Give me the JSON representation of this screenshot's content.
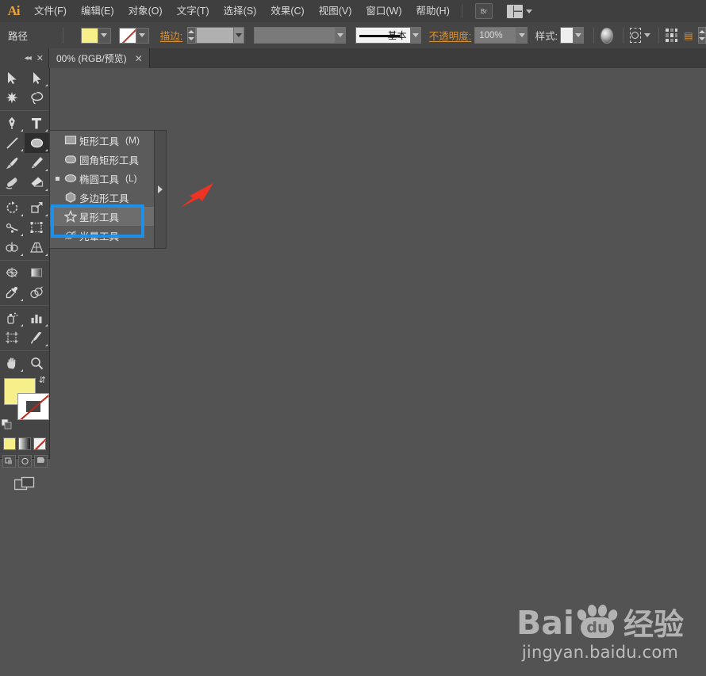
{
  "app": {
    "name": "Ai",
    "logo_color": "#e9a33a"
  },
  "menubar": {
    "items": [
      {
        "label": "文件(F)",
        "name": "menu-file"
      },
      {
        "label": "编辑(E)",
        "name": "menu-edit"
      },
      {
        "label": "对象(O)",
        "name": "menu-object"
      },
      {
        "label": "文字(T)",
        "name": "menu-type"
      },
      {
        "label": "选择(S)",
        "name": "menu-select"
      },
      {
        "label": "效果(C)",
        "name": "menu-effect"
      },
      {
        "label": "视图(V)",
        "name": "menu-view"
      },
      {
        "label": "窗口(W)",
        "name": "menu-window"
      },
      {
        "label": "帮助(H)",
        "name": "menu-help"
      }
    ],
    "bridge_label": "Br",
    "workspace_icon": "workspace-switcher-icon"
  },
  "optionsbar": {
    "selection_label": "路径",
    "fill_color": "#f7ef8a",
    "stroke_color": "none",
    "stroke_label": "描边:",
    "stroke_weight_value": "",
    "brush_definition_value": "",
    "graphic_style_value": "基本",
    "opacity_label": "不透明度:",
    "opacity_value": "100%",
    "style_label": "样式:",
    "transparency_icon": "opacity-sphere-icon",
    "select_similar_icon": "select-similar-icon",
    "align_icon": "align-grid-icon",
    "transform_icon": "transform-icon"
  },
  "tabbar": {
    "collapse_icon": "collapse-panel-icon",
    "close_icon": "close-panel-icon",
    "document_tab": "00% (RGB/预览)",
    "tab_close_icon": "close-tab-icon"
  },
  "toolbox": {
    "rows": [
      [
        {
          "name": "selection-tool",
          "glyph": "cursor-arrow-icon",
          "corner": false
        },
        {
          "name": "direct-selection-tool",
          "glyph": "direct-cursor-icon",
          "corner": true
        }
      ],
      [
        {
          "name": "magic-wand-tool",
          "glyph": "magic-wand-icon",
          "corner": false
        },
        {
          "name": "lasso-tool",
          "glyph": "lasso-icon",
          "corner": false
        }
      ],
      [
        {
          "name": "pen-tool",
          "glyph": "pen-icon",
          "corner": true
        },
        {
          "name": "type-tool",
          "glyph": "type-t-icon",
          "corner": true
        }
      ],
      [
        {
          "name": "line-segment-tool",
          "glyph": "line-icon",
          "corner": true
        },
        {
          "name": "ellipse-tool",
          "glyph": "ellipse-icon",
          "corner": true,
          "selected": true
        }
      ],
      [
        {
          "name": "paintbrush-tool",
          "glyph": "paintbrush-icon",
          "corner": false
        },
        {
          "name": "pencil-tool",
          "glyph": "pencil-icon",
          "corner": true
        }
      ],
      [
        {
          "name": "blob-brush-tool",
          "glyph": "blob-brush-icon",
          "corner": false
        },
        {
          "name": "eraser-tool",
          "glyph": "eraser-icon",
          "corner": true
        }
      ],
      [
        {
          "name": "rotate-tool",
          "glyph": "rotate-icon",
          "corner": true
        },
        {
          "name": "scale-tool",
          "glyph": "scale-icon",
          "corner": true
        }
      ],
      [
        {
          "name": "width-tool",
          "glyph": "width-icon",
          "corner": true
        },
        {
          "name": "free-transform-tool",
          "glyph": "free-transform-icon",
          "corner": false
        }
      ],
      [
        {
          "name": "shape-builder-tool",
          "glyph": "shape-builder-icon",
          "corner": true
        },
        {
          "name": "perspective-grid-tool",
          "glyph": "perspective-grid-icon",
          "corner": true
        }
      ],
      [
        {
          "name": "mesh-tool",
          "glyph": "mesh-icon",
          "corner": false
        },
        {
          "name": "gradient-tool",
          "glyph": "gradient-icon",
          "corner": false
        }
      ],
      [
        {
          "name": "eyedropper-tool",
          "glyph": "eyedropper-icon",
          "corner": true
        },
        {
          "name": "blend-tool",
          "glyph": "blend-icon",
          "corner": false
        }
      ],
      [
        {
          "name": "symbol-sprayer-tool",
          "glyph": "symbol-sprayer-icon",
          "corner": true
        },
        {
          "name": "column-graph-tool",
          "glyph": "bar-graph-icon",
          "corner": true
        }
      ],
      [
        {
          "name": "artboard-tool",
          "glyph": "artboard-icon",
          "corner": false
        },
        {
          "name": "slice-tool",
          "glyph": "slice-knife-icon",
          "corner": true
        }
      ],
      [
        {
          "name": "hand-tool",
          "glyph": "hand-icon",
          "corner": true
        },
        {
          "name": "zoom-tool",
          "glyph": "magnifier-icon",
          "corner": false
        }
      ]
    ],
    "fill_swatch": {
      "name": "fill-swatch",
      "color": "#f7ef8a"
    },
    "stroke_swatch": {
      "name": "stroke-swatch",
      "color": "none"
    },
    "swap_icon": "swap-fill-stroke-icon",
    "default_icon": "default-fill-stroke-icon",
    "color_modes": [
      {
        "name": "color-mode-button",
        "label": "color"
      },
      {
        "name": "gradient-mode-button",
        "label": "gradient"
      },
      {
        "name": "none-mode-button",
        "label": "none"
      }
    ],
    "draw_modes": [
      {
        "name": "draw-normal-button"
      },
      {
        "name": "draw-behind-button"
      },
      {
        "name": "draw-inside-button"
      }
    ],
    "screen_mode": {
      "name": "change-screen-mode-button"
    }
  },
  "flyout": {
    "items": [
      {
        "label": "矩形工具",
        "shortcut": "(M)",
        "icon": "rectangle-icon",
        "marked": false,
        "active": false
      },
      {
        "label": "圆角矩形工具",
        "shortcut": "",
        "icon": "rounded-rectangle-icon",
        "marked": false,
        "active": false
      },
      {
        "label": "椭圆工具",
        "shortcut": "(L)",
        "icon": "ellipse-icon",
        "marked": true,
        "active": false
      },
      {
        "label": "多边形工具",
        "shortcut": "",
        "icon": "polygon-icon",
        "marked": false,
        "active": false
      },
      {
        "label": "星形工具",
        "shortcut": "",
        "icon": "star-icon",
        "marked": false,
        "active": true
      },
      {
        "label": "光晕工具",
        "shortcut": "",
        "icon": "flare-icon",
        "marked": false,
        "active": false
      }
    ],
    "tearoff_icon": "tearoff-handle-icon"
  },
  "annotations": {
    "highlight_box_color": "#1e90e8",
    "arrow_color": "#ee3322",
    "arrow_name": "red-pointer-arrow"
  },
  "watermark": {
    "brand_bai": "Bai",
    "brand_du": "du",
    "brand_cn": "经验",
    "url": "jingyan.baidu.com"
  }
}
